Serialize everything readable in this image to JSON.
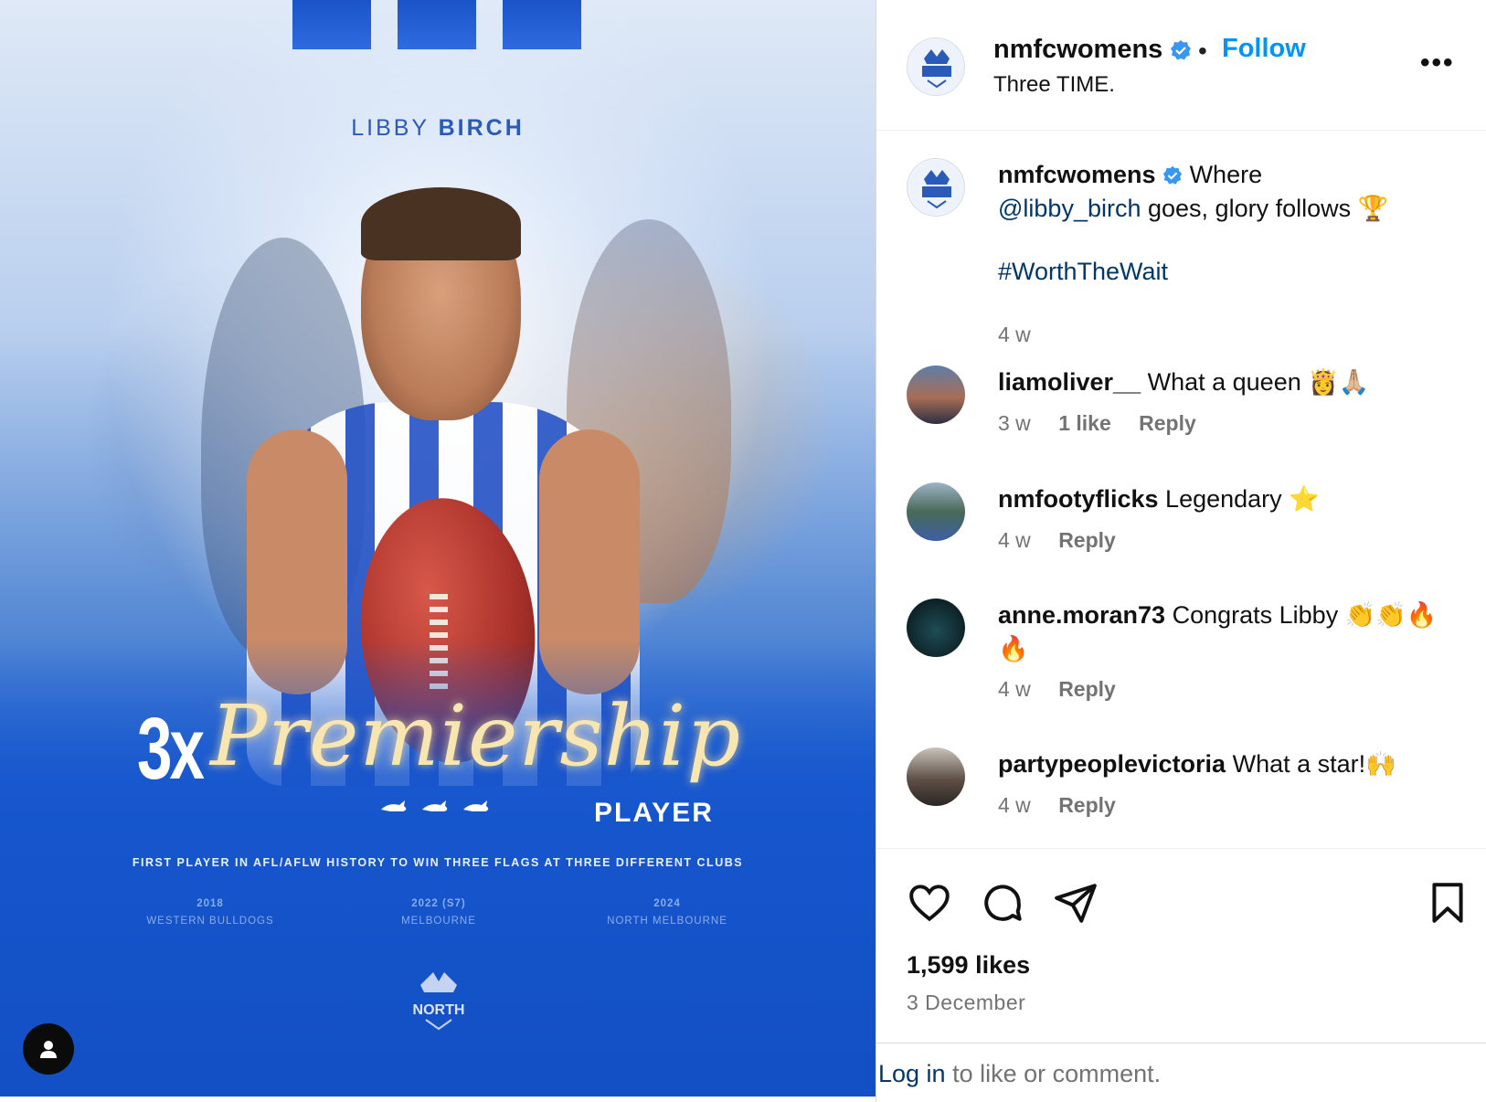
{
  "post_image": {
    "player_first": "LIBBY",
    "player_last": "BIRCH",
    "headline_prefix": "3x",
    "headline_script": "Premiership",
    "headline_suffix": "PLAYER",
    "kangaroo_marks": "⟩⟩⟩",
    "tagline": "FIRST PLAYER IN AFL/AFLW HISTORY TO WIN THREE FLAGS AT THREE DIFFERENT CLUBS",
    "clubs": [
      {
        "year": "2018",
        "club": "WESTERN BULLDOGS"
      },
      {
        "year": "2022 (S7)",
        "club": "MELBOURNE"
      },
      {
        "year": "2024",
        "club": "NORTH MELBOURNE"
      }
    ],
    "logo_text": "NORTH",
    "colors": {
      "brand_blue": "#1350c5",
      "accent_gold": "#f7e6b2"
    }
  },
  "header": {
    "username": "nmfcwomens",
    "separator": "•",
    "follow_label": "Follow",
    "subtitle": "Three TIME.",
    "more_label": "•••"
  },
  "caption": {
    "username": "nmfcwomens",
    "text_1": "Where",
    "mention": "@libby_birch",
    "text_2": "goes, glory follows 🏆",
    "hashtag": "#WorthTheWait",
    "time": "4 w"
  },
  "comments": [
    {
      "username": "liamoliver__",
      "text": "What a queen 👸🙏🏼",
      "time": "3 w",
      "likes": "1 like",
      "reply": "Reply"
    },
    {
      "username": "nmfootyflicks",
      "text": "Legendary ⭐",
      "time": "4 w",
      "reply": "Reply"
    },
    {
      "username": "anne.moran73",
      "text": "Congrats Libby 👏👏🔥🔥",
      "time": "4 w",
      "reply": "Reply"
    },
    {
      "username": "partypeoplevictoria",
      "text": "What a star!🙌",
      "time": "4 w",
      "reply": "Reply"
    }
  ],
  "actions": {
    "likes": "1,599 likes",
    "date": "3 December"
  },
  "login": {
    "link": "Log in",
    "text": " to like or comment."
  },
  "colors": {
    "link_blue": "#0095f6",
    "mention_blue": "#00376b",
    "muted": "#737373"
  }
}
